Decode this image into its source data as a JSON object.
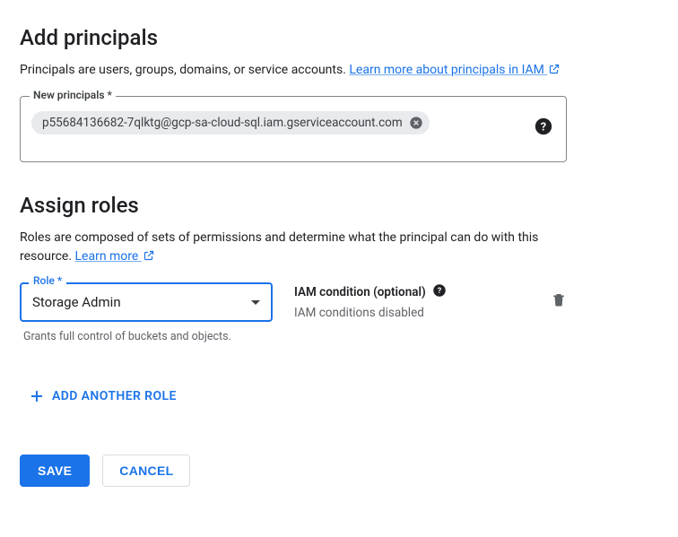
{
  "addPrincipals": {
    "heading": "Add principals",
    "descPrefix": "Principals are users, groups, domains, or service accounts. ",
    "learnMore": "Learn more about principals in IAM",
    "fieldLabel": "New principals *",
    "chipValue": "p55684136682-7qlktg@gcp-sa-cloud-sql.iam.gserviceaccount.com"
  },
  "assignRoles": {
    "heading": "Assign roles",
    "descPrefix": "Roles are composed of sets of permissions and determine what the principal can do with this resource. ",
    "learnMore": "Learn more",
    "roleLabel": "Role *",
    "roleValue": "Storage Admin",
    "roleHelper": "Grants full control of buckets and objects.",
    "conditionTitle": "IAM condition (optional)",
    "conditionStatus": "IAM conditions disabled",
    "addAnother": "ADD ANOTHER ROLE"
  },
  "actions": {
    "save": "SAVE",
    "cancel": "CANCEL"
  }
}
